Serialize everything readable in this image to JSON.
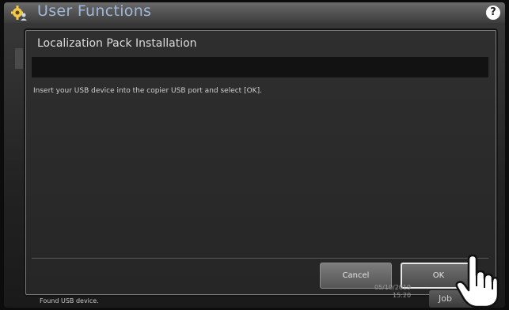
{
  "app": {
    "title": "User Functions",
    "help_label": "?",
    "icon": "gear-user-icon"
  },
  "dialog": {
    "title": "Localization Pack Installation",
    "message": "Insert your USB device into the copier USB port and select [OK].",
    "buttons": {
      "cancel_label": "Cancel",
      "ok_label": "OK"
    }
  },
  "status_bar": {
    "message": "Found USB device.",
    "date": "05/10/2019",
    "time": "15:20",
    "job_label": "Job"
  },
  "pointer": {
    "icon": "hand-pointer-icon"
  },
  "colors": {
    "title_blue": "#9fb7d8",
    "dialog_bg": "#2b2b2b",
    "ok_border": "#e8e8e8"
  }
}
